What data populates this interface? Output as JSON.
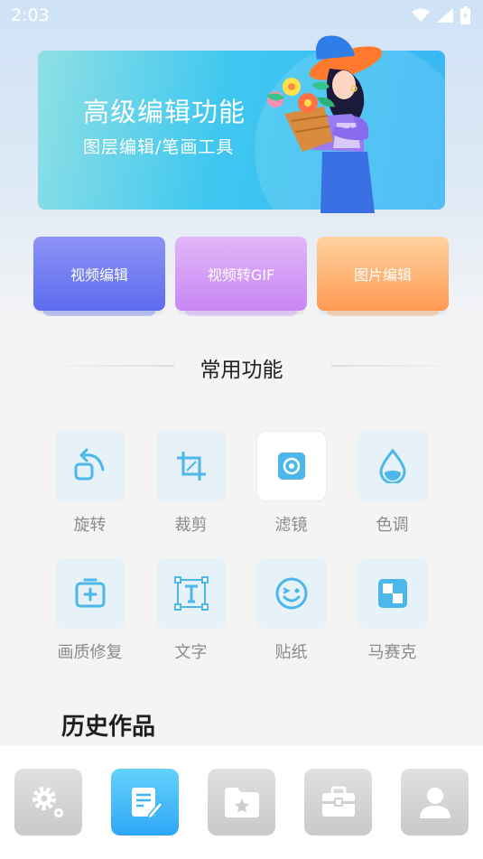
{
  "status_bar": {
    "time": "2:03",
    "icons": [
      "wifi-icon",
      "signal-icon",
      "battery-charging-icon"
    ]
  },
  "banner": {
    "title": "高级编辑功能",
    "subtitle": "图层编辑/笔画工具"
  },
  "feature_cards": [
    {
      "label": "视频编辑",
      "color": "#6e78f2"
    },
    {
      "label": "视频转GIF",
      "color": "#d39cf6"
    },
    {
      "label": "图片编辑",
      "color": "#ffad6c"
    }
  ],
  "section_title": "常用功能",
  "tools": [
    {
      "label": "旋转",
      "icon": "rotate-icon"
    },
    {
      "label": "裁剪",
      "icon": "crop-icon"
    },
    {
      "label": "滤镜",
      "icon": "filter-icon"
    },
    {
      "label": "色调",
      "icon": "color-tone-icon"
    },
    {
      "label": "画质修复",
      "icon": "quality-repair-icon"
    },
    {
      "label": "文字",
      "icon": "text-icon"
    },
    {
      "label": "贴纸",
      "icon": "sticker-icon"
    },
    {
      "label": "马赛克",
      "icon": "mosaic-icon"
    }
  ],
  "history_title": "历史作品",
  "bottom_nav": [
    {
      "icon": "settings-icon",
      "active": false
    },
    {
      "icon": "edit-note-icon",
      "active": true
    },
    {
      "icon": "folder-star-icon",
      "active": false
    },
    {
      "icon": "briefcase-icon",
      "active": false
    },
    {
      "icon": "user-icon",
      "active": false
    }
  ],
  "colors": {
    "accent": "#3fb4f5",
    "icon_tint": "#4bb7ea",
    "tool_bg": "#e6f1f8"
  }
}
